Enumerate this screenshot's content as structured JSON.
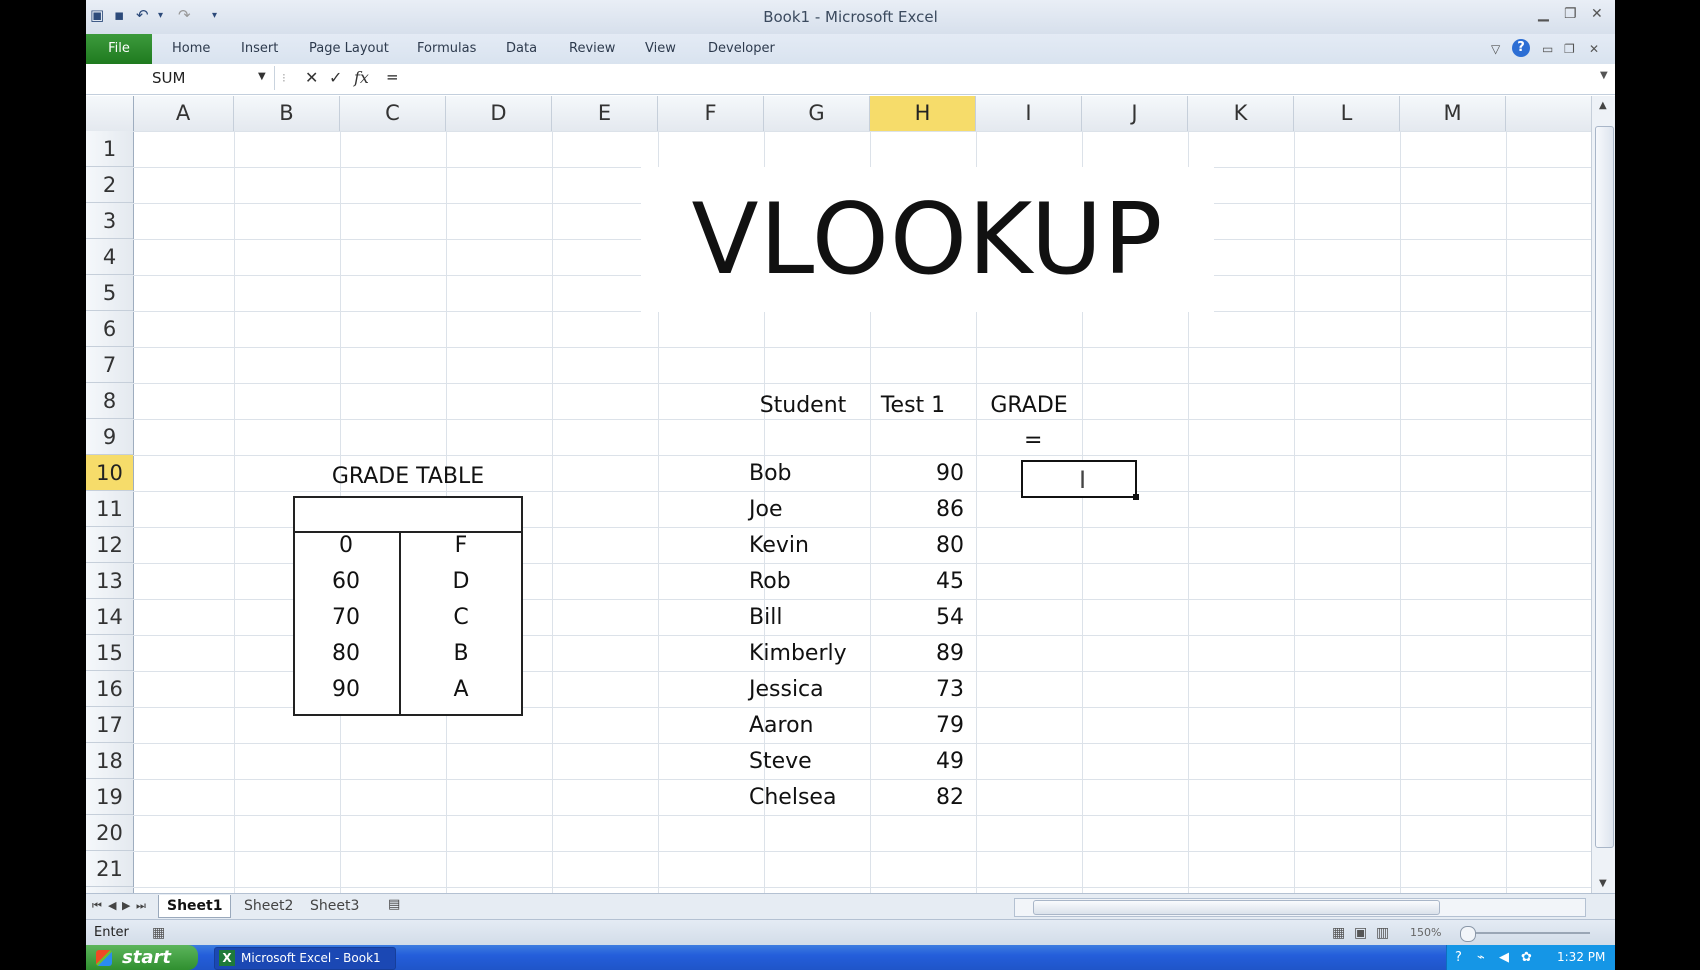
{
  "window": {
    "title": "Book1  -  Microsoft Excel"
  },
  "ribbon": {
    "file_label": "File",
    "tabs": [
      "Home",
      "Insert",
      "Page Layout",
      "Formulas",
      "Data",
      "Review",
      "View",
      "Developer"
    ],
    "help_label": "?"
  },
  "formula_bar": {
    "name_box": "SUM",
    "cancel_label": "✕",
    "enter_label": "✓",
    "fx_label": "fx",
    "formula": "="
  },
  "columns": [
    "A",
    "B",
    "C",
    "D",
    "E",
    "F",
    "G",
    "H",
    "I",
    "J",
    "K",
    "L",
    "M"
  ],
  "rows": [
    "1",
    "2",
    "3",
    "4",
    "5",
    "6",
    "7",
    "8",
    "9",
    "10",
    "11",
    "12",
    "13",
    "14",
    "15",
    "16",
    "17",
    "18",
    "19",
    "20",
    "21"
  ],
  "selection": {
    "column": "H",
    "row": "10"
  },
  "sheet": {
    "banner": "VLOOKUP",
    "grade_table": {
      "title": "GRADE TABLE",
      "rows": [
        {
          "score": "0",
          "grade": "F"
        },
        {
          "score": "60",
          "grade": "D"
        },
        {
          "score": "70",
          "grade": "C"
        },
        {
          "score": "80",
          "grade": "B"
        },
        {
          "score": "90",
          "grade": "A"
        }
      ]
    },
    "students_header": {
      "student": "Student",
      "test": "Test 1",
      "grade": "GRADE"
    },
    "students": [
      {
        "name": "Bob",
        "score": "90"
      },
      {
        "name": "Joe",
        "score": "86"
      },
      {
        "name": "Kevin",
        "score": "80"
      },
      {
        "name": "Rob",
        "score": "45"
      },
      {
        "name": "Bill",
        "score": "54"
      },
      {
        "name": "Kimberly",
        "score": "89"
      },
      {
        "name": "Jessica",
        "score": "73"
      },
      {
        "name": "Aaron",
        "score": "79"
      },
      {
        "name": "Steve",
        "score": "49"
      },
      {
        "name": "Chelsea",
        "score": "82"
      }
    ],
    "active_cell_text": "="
  },
  "sheet_tabs": [
    "Sheet1",
    "Sheet2",
    "Sheet3"
  ],
  "status": {
    "mode": "Enter",
    "zoom": "150%"
  },
  "taskbar": {
    "start_label": "start",
    "task_label": "Microsoft Excel - Book1",
    "clock": "1:32 PM"
  }
}
